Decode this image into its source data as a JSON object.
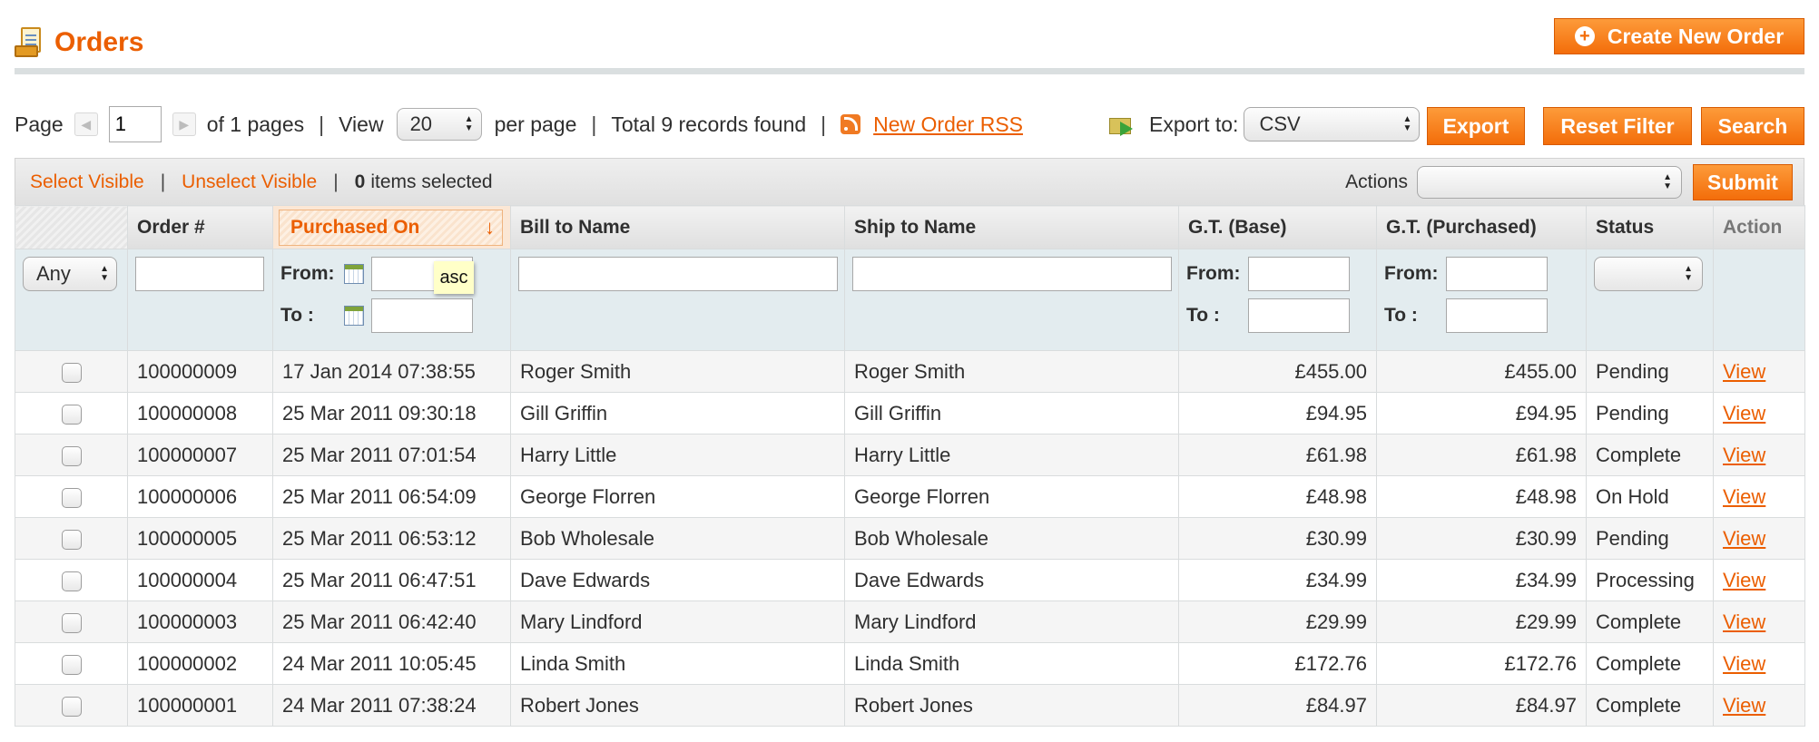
{
  "header": {
    "title": "Orders",
    "create_button": "Create New Order",
    "create_icon": "+"
  },
  "pager": {
    "page_label": "Page",
    "page_value": "1",
    "of_pages": "of 1 pages",
    "separator": "|",
    "view_label": "View",
    "per_page_value": "20",
    "per_page_label": "per page",
    "total": "Total 9 records found",
    "rss_link": "New Order RSS"
  },
  "export": {
    "label": "Export to:",
    "format": "CSV",
    "export_button": "Export",
    "reset_button": "Reset Filter",
    "search_button": "Search"
  },
  "massaction": {
    "select_visible": "Select Visible",
    "unselect_visible": "Unselect Visible",
    "selected_count": "0",
    "selected_label": "items selected",
    "actions_label": "Actions",
    "submit_button": "Submit"
  },
  "columns": {
    "order": "Order #",
    "purchased_on": "Purchased On",
    "bill_to": "Bill to Name",
    "ship_to": "Ship to Name",
    "gt_base": "G.T. (Base)",
    "gt_purchased": "G.T. (Purchased)",
    "status": "Status",
    "action": "Action",
    "sort_arrow": "↓"
  },
  "filters": {
    "any": "Any",
    "from": "From:",
    "to": "To :",
    "tooltip": "asc"
  },
  "rows": [
    {
      "order": "100000009",
      "date": "17 Jan 2014 07:38:55",
      "bill": "Roger Smith",
      "ship": "Roger Smith",
      "base": "£455.00",
      "purchased": "£455.00",
      "status": "Pending",
      "action": "View"
    },
    {
      "order": "100000008",
      "date": "25 Mar 2011 09:30:18",
      "bill": "Gill Griffin",
      "ship": "Gill Griffin",
      "base": "£94.95",
      "purchased": "£94.95",
      "status": "Pending",
      "action": "View"
    },
    {
      "order": "100000007",
      "date": "25 Mar 2011 07:01:54",
      "bill": "Harry Little",
      "ship": "Harry Little",
      "base": "£61.98",
      "purchased": "£61.98",
      "status": "Complete",
      "action": "View"
    },
    {
      "order": "100000006",
      "date": "25 Mar 2011 06:54:09",
      "bill": "George Florren",
      "ship": "George Florren",
      "base": "£48.98",
      "purchased": "£48.98",
      "status": "On Hold",
      "action": "View"
    },
    {
      "order": "100000005",
      "date": "25 Mar 2011 06:53:12",
      "bill": "Bob Wholesale",
      "ship": "Bob Wholesale",
      "base": "£30.99",
      "purchased": "£30.99",
      "status": "Pending",
      "action": "View"
    },
    {
      "order": "100000004",
      "date": "25 Mar 2011 06:47:51",
      "bill": "Dave Edwards",
      "ship": "Dave Edwards",
      "base": "£34.99",
      "purchased": "£34.99",
      "status": "Processing",
      "action": "View"
    },
    {
      "order": "100000003",
      "date": "25 Mar 2011 06:42:40",
      "bill": "Mary Lindford",
      "ship": "Mary Lindford",
      "base": "£29.99",
      "purchased": "£29.99",
      "status": "Complete",
      "action": "View"
    },
    {
      "order": "100000002",
      "date": "24 Mar 2011 10:05:45",
      "bill": "Linda Smith",
      "ship": "Linda Smith",
      "base": "£172.76",
      "purchased": "£172.76",
      "status": "Complete",
      "action": "View"
    },
    {
      "order": "100000001",
      "date": "24 Mar 2011 07:38:24",
      "bill": "Robert Jones",
      "ship": "Robert Jones",
      "base": "£84.97",
      "purchased": "£84.97",
      "status": "Complete",
      "action": "View"
    }
  ],
  "colors": {
    "accent": "#eb5e00",
    "button": "#f36d0a",
    "filter_bg": "#e3ecef"
  }
}
